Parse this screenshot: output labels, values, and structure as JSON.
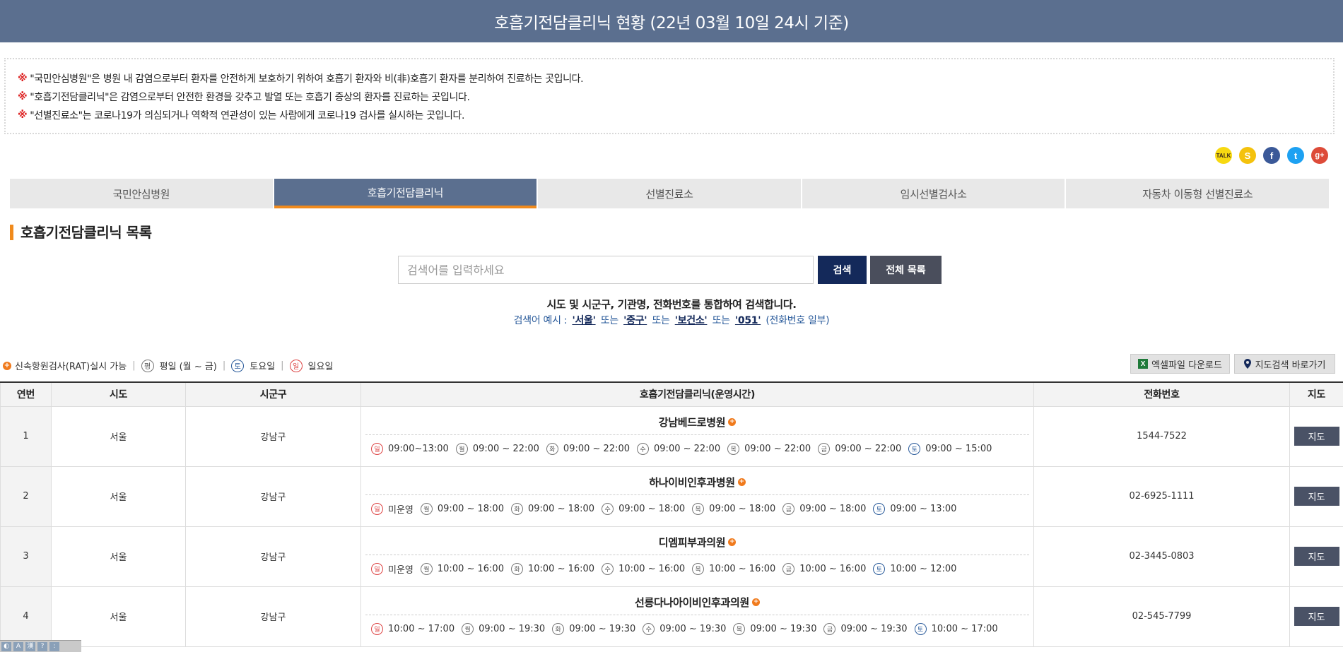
{
  "header": {
    "title": "호흡기전담클리닉 현황 (22년 03월 10일 24시 기준)"
  },
  "notice": {
    "mark": "※",
    "lines": [
      "\"국민안심병원\"은 병원 내 감염으로부터 환자를 안전하게 보호하기 위하여 호흡기 환자와 비(非)호흡기 환자를 분리하여 진료하는 곳입니다.",
      "\"호흡기전담클리닉\"은 감염으로부터 안전한 환경을 갖추고 발열 또는 호흡기 증상의 환자를 진료하는 곳입니다.",
      "\"선별진료소\"는 코로나19가 의심되거나 역학적 연관성이 있는 사람에게 코로나19 검사를 실시하는 곳입니다."
    ]
  },
  "share": {
    "icons": [
      "kakaotalk-icon",
      "kakaostory-icon",
      "facebook-icon",
      "twitter-icon",
      "google-plus-icon"
    ]
  },
  "tabs": [
    {
      "label": "국민안심병원",
      "active": false
    },
    {
      "label": "호흡기전담클리닉",
      "active": true
    },
    {
      "label": "선별진료소",
      "active": false
    },
    {
      "label": "임시선별검사소",
      "active": false
    },
    {
      "label": "자동차 이동형 선별진료소",
      "active": false
    }
  ],
  "section": {
    "title": "호흡기전담클리닉 목록"
  },
  "search": {
    "placeholder": "검색어를 입력하세요",
    "value": "",
    "search_label": "검색",
    "all_label": "전체 목록",
    "guide": "시도 및 시군구, 기관명, 전화번호를 통합하여 검색합니다.",
    "example_prefix": "검색어 예시 :",
    "or": "또는",
    "kw1": "'서울'",
    "kw2": "'중구'",
    "kw3": "'보건소'",
    "kw4": "'051'",
    "example_suffix": "(전화번호 일부)"
  },
  "legend": {
    "rat": "신속항원검사(RAT)실시 가능",
    "weekday_glyph": "평",
    "weekday": "평일 (월 ~ 금)",
    "sat_glyph": "토",
    "sat": "토요일",
    "sun_glyph": "일",
    "sun": "일요일",
    "sep": "|"
  },
  "actions": {
    "excel_label": "엑셀파일 다운로드",
    "map_search_label": "지도검색 바로가기"
  },
  "table": {
    "headers": {
      "no": "연번",
      "sido": "시도",
      "sigungu": "시군구",
      "clinic": "호흡기전담클리닉(운영시간)",
      "phone": "전화번호",
      "map": "지도"
    },
    "day_glyphs": [
      "일",
      "월",
      "화",
      "수",
      "목",
      "금",
      "토"
    ],
    "map_label": "지도",
    "rows": [
      {
        "no": "1",
        "sido": "서울",
        "sigungu": "강남구",
        "name": "강남베드로병원",
        "phone": "1544-7522",
        "hours": [
          "09:00~13:00",
          "09:00 ~ 22:00",
          "09:00 ~ 22:00",
          "09:00 ~ 22:00",
          "09:00 ~ 22:00",
          "09:00 ~ 22:00",
          "09:00 ~ 15:00"
        ]
      },
      {
        "no": "2",
        "sido": "서울",
        "sigungu": "강남구",
        "name": "하나이비인후과병원",
        "phone": "02-6925-1111",
        "hours": [
          "미운영",
          "09:00 ~ 18:00",
          "09:00 ~ 18:00",
          "09:00 ~ 18:00",
          "09:00 ~ 18:00",
          "09:00 ~ 18:00",
          "09:00 ~ 13:00"
        ]
      },
      {
        "no": "3",
        "sido": "서울",
        "sigungu": "강남구",
        "name": "디엠피부과의원",
        "phone": "02-3445-0803",
        "hours": [
          "미운영",
          "10:00 ~ 16:00",
          "10:00 ~ 16:00",
          "10:00 ~ 16:00",
          "10:00 ~ 16:00",
          "10:00 ~ 16:00",
          "10:00 ~ 12:00"
        ]
      },
      {
        "no": "4",
        "sido": "서울",
        "sigungu": "강남구",
        "name": "선릉다나아이비인후과의원",
        "phone": "02-545-7799",
        "hours": [
          "10:00 ~ 17:00",
          "09:00 ~ 19:30",
          "09:00 ~ 19:30",
          "09:00 ~ 19:30",
          "09:00 ~ 19:30",
          "09:00 ~ 19:30",
          "10:00 ~ 17:00"
        ]
      }
    ]
  },
  "colors": {
    "header_bg": "#5b6f8f",
    "accent_orange": "#f08a1c",
    "search_btn": "#14295a",
    "sun_red": "#dd4444",
    "sat_blue": "#2a5b9b"
  }
}
